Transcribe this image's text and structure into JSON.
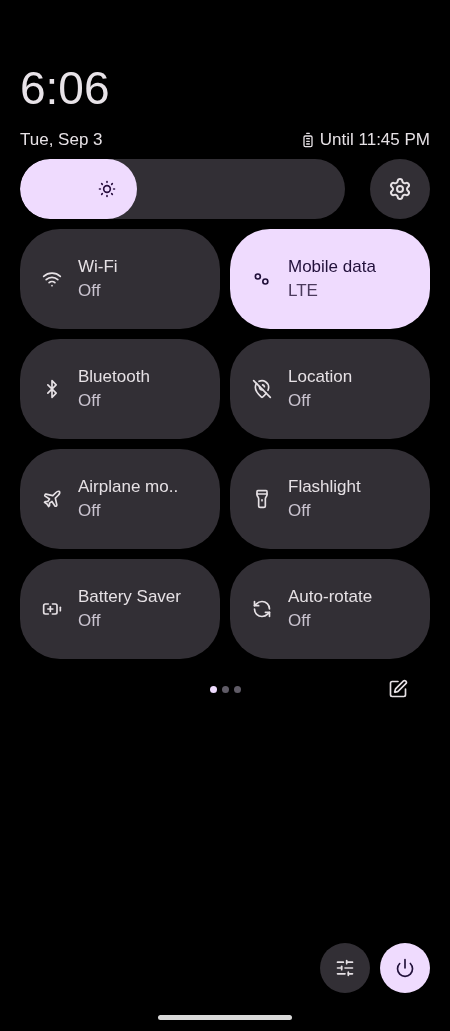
{
  "clock": {
    "time": "6:06",
    "date": "Tue, Sep 3",
    "battery": "Until 11:45 PM"
  },
  "brightness": {
    "level": 0.36
  },
  "tiles": [
    {
      "label": "Wi-Fi",
      "status": "Off",
      "selected": false
    },
    {
      "label": "Mobile data",
      "status": "LTE",
      "selected": true
    },
    {
      "label": "Bluetooth",
      "status": "Off",
      "selected": false
    },
    {
      "label": "Location",
      "status": "Off",
      "selected": false
    },
    {
      "label": "Airplane mo..",
      "status": "Off",
      "selected": false
    },
    {
      "label": "Flashlight",
      "status": "Off",
      "selected": false
    },
    {
      "label": "Battery Saver",
      "status": "Off",
      "selected": false
    },
    {
      "label": "Auto-rotate",
      "status": "Off",
      "selected": false
    }
  ],
  "pages": [
    {
      "selected": true
    },
    {
      "selected": false
    },
    {
      "selected": false
    }
  ]
}
